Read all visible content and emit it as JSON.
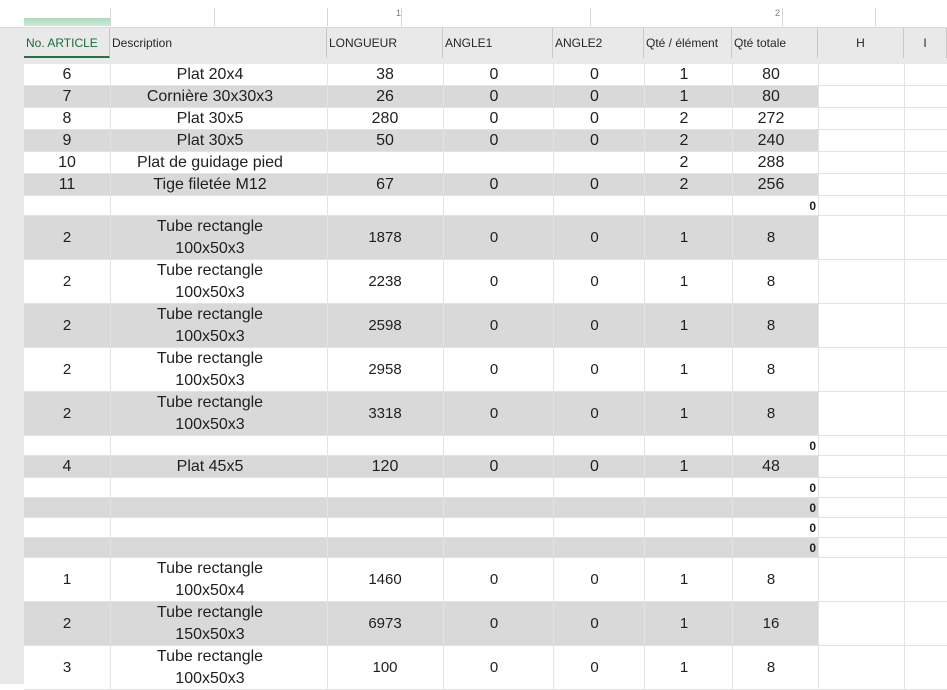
{
  "column_markers": [
    "1",
    "2"
  ],
  "columns": [
    {
      "key": "no",
      "label": "No. ARTICLE"
    },
    {
      "key": "desc",
      "label": "Description"
    },
    {
      "key": "len",
      "label": "LONGUEUR"
    },
    {
      "key": "a1",
      "label": "ANGLE1"
    },
    {
      "key": "a2",
      "label": "ANGLE2"
    },
    {
      "key": "qe",
      "label": "Qté /  élément"
    },
    {
      "key": "qt",
      "label": "Qté  totale"
    },
    {
      "key": "h",
      "label": "H"
    },
    {
      "key": "i",
      "label": "I"
    }
  ],
  "rows": [
    {
      "shaded": false,
      "double": false,
      "no": "6",
      "desc": [
        "Plat 20x4"
      ],
      "len": "38",
      "a1": "0",
      "a2": "0",
      "qe": "1",
      "qt": "80",
      "side": ""
    },
    {
      "shaded": true,
      "double": false,
      "no": "7",
      "desc": [
        "Cornière 30x30x3"
      ],
      "len": "26",
      "a1": "0",
      "a2": "0",
      "qe": "1",
      "qt": "80",
      "side": ""
    },
    {
      "shaded": false,
      "double": false,
      "no": "8",
      "desc": [
        "Plat 30x5"
      ],
      "len": "280",
      "a1": "0",
      "a2": "0",
      "qe": "2",
      "qt": "272",
      "side": ""
    },
    {
      "shaded": true,
      "double": false,
      "no": "9",
      "desc": [
        "Plat 30x5"
      ],
      "len": "50",
      "a1": "0",
      "a2": "0",
      "qe": "2",
      "qt": "240",
      "side": ""
    },
    {
      "shaded": false,
      "double": false,
      "no": "10",
      "desc": [
        "Plat de guidage pied"
      ],
      "len": "",
      "a1": "",
      "a2": "",
      "qe": "2",
      "qt": "288",
      "side": ""
    },
    {
      "shaded": true,
      "double": false,
      "no": "11",
      "desc": [
        "Tige filetée M12"
      ],
      "len": "67",
      "a1": "0",
      "a2": "0",
      "qe": "2",
      "qt": "256",
      "side": ""
    },
    {
      "shaded": false,
      "double": false,
      "blank": true,
      "no": "",
      "desc": [
        ""
      ],
      "len": "",
      "a1": "",
      "a2": "",
      "qe": "",
      "qt": "",
      "side": "0"
    },
    {
      "shaded": true,
      "double": true,
      "no": "2",
      "desc": [
        "Tube rectangle",
        "100x50x3"
      ],
      "len": "1878",
      "a1": "0",
      "a2": "0",
      "qe": "1",
      "qt": "8",
      "side": ""
    },
    {
      "shaded": false,
      "double": true,
      "no": "2",
      "desc": [
        "Tube rectangle",
        "100x50x3"
      ],
      "len": "2238",
      "a1": "0",
      "a2": "0",
      "qe": "1",
      "qt": "8",
      "side": ""
    },
    {
      "shaded": true,
      "double": true,
      "no": "2",
      "desc": [
        "Tube rectangle",
        "100x50x3"
      ],
      "len": "2598",
      "a1": "0",
      "a2": "0",
      "qe": "1",
      "qt": "8",
      "side": ""
    },
    {
      "shaded": false,
      "double": true,
      "no": "2",
      "desc": [
        "Tube rectangle",
        "100x50x3"
      ],
      "len": "2958",
      "a1": "0",
      "a2": "0",
      "qe": "1",
      "qt": "8",
      "side": ""
    },
    {
      "shaded": true,
      "double": true,
      "no": "2",
      "desc": [
        "Tube rectangle",
        "100x50x3"
      ],
      "len": "3318",
      "a1": "0",
      "a2": "0",
      "qe": "1",
      "qt": "8",
      "side": ""
    },
    {
      "shaded": false,
      "double": false,
      "blank": true,
      "no": "",
      "desc": [
        ""
      ],
      "len": "",
      "a1": "",
      "a2": "",
      "qe": "",
      "qt": "",
      "side": "0"
    },
    {
      "shaded": true,
      "double": false,
      "no": "4",
      "desc": [
        "Plat 45x5"
      ],
      "len": "120",
      "a1": "0",
      "a2": "0",
      "qe": "1",
      "qt": "48",
      "side": ""
    },
    {
      "shaded": false,
      "double": false,
      "blank": true,
      "no": "",
      "desc": [
        ""
      ],
      "len": "",
      "a1": "",
      "a2": "",
      "qe": "",
      "qt": "",
      "side": "0"
    },
    {
      "shaded": true,
      "double": false,
      "blank": true,
      "no": "",
      "desc": [
        ""
      ],
      "len": "",
      "a1": "",
      "a2": "",
      "qe": "",
      "qt": "",
      "side": "0"
    },
    {
      "shaded": false,
      "double": false,
      "blank": true,
      "no": "",
      "desc": [
        ""
      ],
      "len": "",
      "a1": "",
      "a2": "",
      "qe": "",
      "qt": "",
      "side": "0"
    },
    {
      "shaded": true,
      "double": false,
      "blank": true,
      "no": "",
      "desc": [
        ""
      ],
      "len": "",
      "a1": "",
      "a2": "",
      "qe": "",
      "qt": "",
      "side": "0"
    },
    {
      "shaded": false,
      "double": true,
      "no": "1",
      "desc": [
        "Tube rectangle",
        "100x50x4"
      ],
      "len": "1460",
      "a1": "0",
      "a2": "0",
      "qe": "1",
      "qt": "8",
      "side": ""
    },
    {
      "shaded": true,
      "double": true,
      "no": "2",
      "desc": [
        "Tube rectangle",
        "150x50x3"
      ],
      "len": "6973",
      "a1": "0",
      "a2": "0",
      "qe": "1",
      "qt": "16",
      "side": ""
    },
    {
      "shaded": false,
      "double": true,
      "no": "3",
      "desc": [
        "Tube rectangle",
        "100x50x3"
      ],
      "len": "100",
      "a1": "0",
      "a2": "0",
      "qe": "1",
      "qt": "8",
      "side": ""
    }
  ],
  "colors": {
    "shade": "#d9d9d9",
    "header": "#e9e9e9",
    "selected": "#217346"
  }
}
